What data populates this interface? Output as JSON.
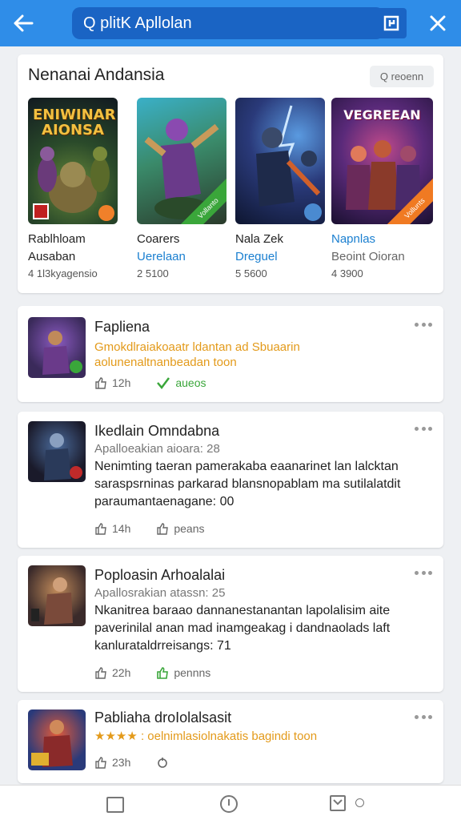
{
  "search": {
    "query": "Q plitK Apllolan"
  },
  "featured": {
    "title": "Nenanai Andansia",
    "filter_label": "Q reoenn",
    "tiles": [
      {
        "line1": "Rablhloam",
        "line2": "Ausaban",
        "line3": "4 1l3kyagensio",
        "banner": "ENIWINAR AIONSA",
        "corner": ""
      },
      {
        "line1": "Coarers",
        "line2": "Uerelaan",
        "line3": "2 5100",
        "banner": "",
        "corner": "Vollanto"
      },
      {
        "line1": "Nala Zek",
        "line2": "Dreguel",
        "line3": "5 5600",
        "banner": "",
        "corner": ""
      },
      {
        "line1": "Napnlas",
        "line2": "Beoint Oioran",
        "line3": "4 3900",
        "banner": "VEGREEAN",
        "corner": "Vollunts"
      }
    ]
  },
  "items": [
    {
      "title": "Fapliena",
      "sub": "Gmokdlraiakoaatr ldantan ad Sbuaarin aolunenaltnanbeadan toon",
      "body": "",
      "meta_left": "12h",
      "meta_right": "aueos"
    },
    {
      "title": "Ikedlain Omndabna",
      "sub": "Apalloeakian aioara: 28",
      "body": "Nenimting taeran pamerakaba eaanarinet lan lalcktan saraspsrninas parkarad blansnopablam ma sutilalatdit paraumantaenagane: 00",
      "meta_left": "14h",
      "meta_right": "peans"
    },
    {
      "title": "Poploasin Arhoalalai",
      "sub": "Apallosrakian atassn: 25",
      "body": "Nkanitrea baraao dannanestanantan lapolalisim aite paverinilal anan mad inamgeakag i dandnaolads laft kanlurataldrreisangs: 71",
      "meta_left": "22h",
      "meta_right": "pennns"
    },
    {
      "title": "Pabliaha droIolalsasit",
      "sub": "★★★★ : oelnimlasiolnakatis bagindi toon",
      "body": "",
      "meta_left": "23h",
      "meta_right": ""
    }
  ]
}
